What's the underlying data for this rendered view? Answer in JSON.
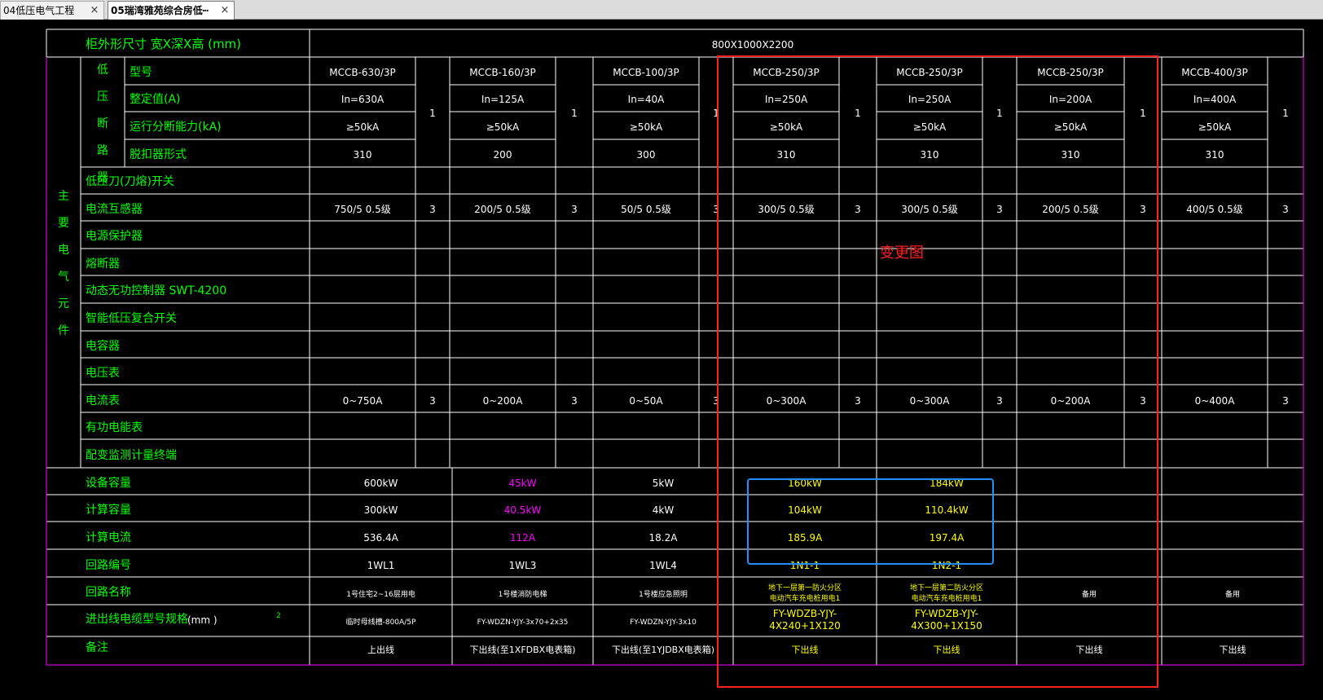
{
  "tabs": [
    {
      "label": "04低压电气工程",
      "close": "×"
    },
    {
      "label": "05瑞湾雅苑综合房低┅",
      "close": "×"
    }
  ],
  "colors": {
    "green": "#00ff00",
    "white": "#ffffff",
    "yellow": "#ffff00",
    "magenta": "#ff00ff",
    "red": "#ff2020",
    "blue": "#1e90ff"
  },
  "table": {
    "cabinet_size_label": "柜外形尺寸  宽X深X高     (mm)",
    "cabinet_size_value": "800X1000X2200",
    "main_elements_label": [
      "主",
      "要",
      "电",
      "气",
      "元",
      "件"
    ],
    "breaker_label": [
      "低",
      "压",
      "断",
      "路",
      "器"
    ],
    "row_labels": {
      "model": "型号",
      "setting": "整定值(A)",
      "breaking": "运行分断能力(kA)",
      "trip": "脱扣器形式",
      "knife": "低压刀(刀熔)开关",
      "ct": "电流互感器",
      "leak": "电源保护器",
      "fuse": "熔断器",
      "reactive": "动态无功控制器 SWT-4200",
      "smart_switch": "智能低压复合开关",
      "capacitor": "电容器",
      "voltmeter": "电压表",
      "ammeter": "电流表",
      "energy": "有功电能表",
      "monitor": "配变监测计量终端",
      "capacity": "设备容量",
      "calc_cap": "计算容量",
      "calc_current": "计算电流",
      "circuit_no": "回路编号",
      "circuit_name": "回路名称",
      "cable_label": "进出线电缆型号规格",
      "cable_unit": "(mm )",
      "cable_sup": "2",
      "remark": "备注"
    },
    "columns": [
      {
        "model": "MCCB-630/3P",
        "setting": "In=630A",
        "breaking": "≥50kA",
        "trip": "310",
        "ct": "750/5   0.5级",
        "ammeter": "0~750A",
        "capacity": "600kW",
        "calc": "300kW",
        "current": "536.4A",
        "no": "1WL1",
        "name": [
          "1号住宅2~16层用电",
          ""
        ],
        "cable": [
          "临时母线槽-800A/5P",
          ""
        ],
        "remark": "上出线",
        "qty1": "1",
        "qty_ct": "3",
        "qty_am": "3"
      },
      {
        "model": "MCCB-160/3P",
        "setting": "In=125A",
        "breaking": "≥50kA",
        "trip": "200",
        "ct": "200/5   0.5级",
        "ammeter": "0~200A",
        "capacity": "45kW",
        "calc": "40.5kW",
        "current": "112A",
        "no": "1WL3",
        "name": [
          "1号楼消防电梯",
          ""
        ],
        "cable": [
          "FY-WDZN-YJY-3x70+2x35",
          ""
        ],
        "remark": "下出线(至1XFDBX电表箱)",
        "qty1": "1",
        "qty_ct": "3",
        "qty_am": "3"
      },
      {
        "model": "MCCB-100/3P",
        "setting": "In=40A",
        "breaking": "≥50kA",
        "trip": "300",
        "ct": "50/5   0.5级",
        "ammeter": "0~50A",
        "capacity": "5kW",
        "calc": "4kW",
        "current": "18.2A",
        "no": "1WL4",
        "name": [
          "1号楼应急照明",
          ""
        ],
        "cable": [
          "FY-WDZN-YJY-3x10",
          ""
        ],
        "remark": "下出线(至1YJDBX电表箱)",
        "qty1": "1",
        "qty_ct": "3",
        "qty_am": "3"
      },
      {
        "model": "MCCB-250/3P",
        "setting": "In=250A",
        "breaking": "≥50kA",
        "trip": "310",
        "ct": "300/5   0.5级",
        "ammeter": "0~300A",
        "capacity": "160kW",
        "calc": "104kW",
        "current": "185.9A",
        "no": "1N1-1",
        "name": [
          "地下一层第一防火分区",
          "电动汽车充电桩用电1"
        ],
        "cable": [
          "FY-WDZB-YJY-",
          "4X240+1X120"
        ],
        "remark": "下出线",
        "qty1": "1",
        "qty_ct": "3",
        "qty_am": "3"
      },
      {
        "model": "MCCB-250/3P",
        "setting": "In=250A",
        "breaking": "≥50kA",
        "trip": "310",
        "ct": "300/5   0.5级",
        "ammeter": "0~300A",
        "capacity": "184kW",
        "calc": "110.4kW",
        "current": "197.4A",
        "no": "1N2-1",
        "name": [
          "地下一层第二防火分区",
          "电动汽车充电桩用电1"
        ],
        "cable": [
          "FY-WDZB-YJY-",
          "4X300+1X150"
        ],
        "remark": "下出线",
        "qty1": "1",
        "qty_ct": "3",
        "qty_am": "3"
      },
      {
        "model": "MCCB-250/3P",
        "setting": "In=200A",
        "breaking": "≥50kA",
        "trip": "310",
        "ct": "200/5   0.5级",
        "ammeter": "0~200A",
        "capacity": "",
        "calc": "",
        "current": "",
        "no": "",
        "name": [
          "备用",
          ""
        ],
        "cable": [
          "",
          ""
        ],
        "remark": "下出线",
        "qty1": "1",
        "qty_ct": "3",
        "qty_am": "3"
      },
      {
        "model": "MCCB-400/3P",
        "setting": "In=400A",
        "breaking": "≥50kA",
        "trip": "310",
        "ct": "400/5   0.5级",
        "ammeter": "0~400A",
        "capacity": "",
        "calc": "",
        "current": "",
        "no": "",
        "name": [
          "备用",
          ""
        ],
        "cable": [
          "",
          ""
        ],
        "remark": "下出线",
        "qty1": "1",
        "qty_ct": "3",
        "qty_am": "3"
      }
    ]
  },
  "annotation": {
    "label": "变更图"
  }
}
